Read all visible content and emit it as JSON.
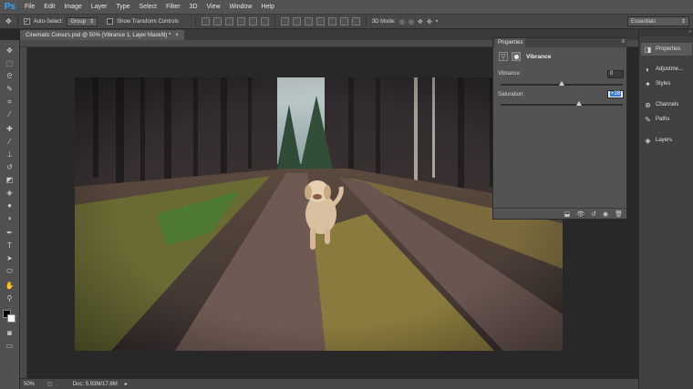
{
  "app": {
    "logo": "Ps"
  },
  "menu": [
    "File",
    "Edit",
    "Image",
    "Layer",
    "Type",
    "Select",
    "Filter",
    "3D",
    "View",
    "Window",
    "Help"
  ],
  "options": {
    "auto_select_label": "Auto-Select:",
    "auto_select_value": "Group",
    "transform_label": "Show Transform Controls",
    "mode_label": "3D Mode:",
    "workspace": "Essentials"
  },
  "document": {
    "tab_title": "Cinematic Colours.psd @ 50% (Vibrance 1, Layer Mask/8) *",
    "close": "×"
  },
  "status": {
    "zoom": "50%",
    "doc_info": "Doc: 5.93M/17.8M"
  },
  "properties": {
    "tab": "Properties",
    "title": "Vibrance",
    "vibrance_label": "Vibrance:",
    "vibrance_value": "0",
    "vibrance": 0,
    "saturation_label": "Saturation:",
    "saturation_value": "+28",
    "saturation": 28
  },
  "dock": {
    "items": [
      "Properties",
      "Adjustme...",
      "Styles",
      "Channels",
      "Paths",
      "Layers"
    ]
  }
}
